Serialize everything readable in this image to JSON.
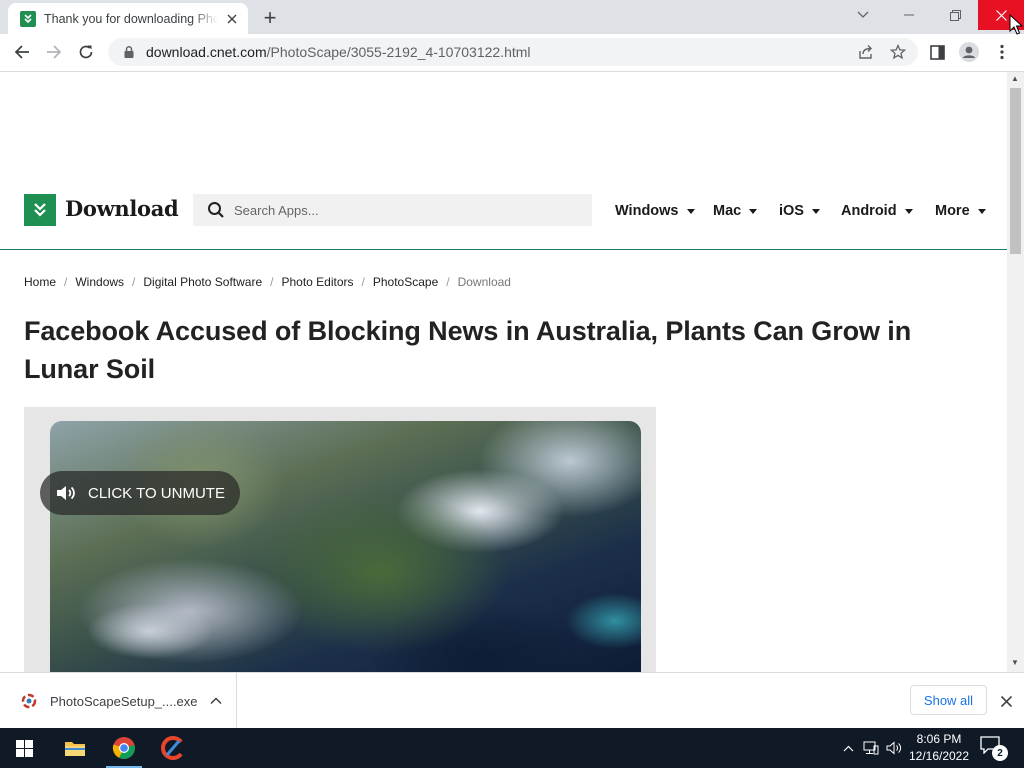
{
  "browser": {
    "tab": {
      "title": "Thank you for downloading PhotoScape",
      "favicon": "download-favicon-icon"
    },
    "new_tab_symbol": "+",
    "url": {
      "host": "download.cnet.com",
      "path": "/PhotoScape/3055-2192_4-10703122.html"
    }
  },
  "site": {
    "logo_text": "Download",
    "search_placeholder": "Search Apps...",
    "nav": [
      {
        "label": "Windows"
      },
      {
        "label": "Mac"
      },
      {
        "label": "iOS"
      },
      {
        "label": "Android"
      },
      {
        "label": "More"
      }
    ]
  },
  "breadcrumb": [
    {
      "label": "Home"
    },
    {
      "label": "Windows"
    },
    {
      "label": "Digital Photo Software"
    },
    {
      "label": "Photo Editors"
    },
    {
      "label": "PhotoScape"
    },
    {
      "label": "Download"
    }
  ],
  "breadcrumb_separator": "/",
  "article": {
    "headline": "Facebook Accused of Blocking News in Australia, Plants Can Grow in Lunar Soil"
  },
  "video": {
    "unmute_label": "CLICK TO UNMUTE"
  },
  "download_shelf": {
    "file_name": "PhotoScapeSetup_....exe",
    "show_all_label": "Show all"
  },
  "taskbar": {
    "time": "8:06 PM",
    "date": "12/16/2022",
    "notification_count": "2"
  },
  "colors": {
    "brand_green": "#1f8f52",
    "header_border": "#1b7a6c",
    "close_red": "#e81123",
    "taskbar_bg": "#101a26",
    "link_blue": "#1a73e8"
  }
}
